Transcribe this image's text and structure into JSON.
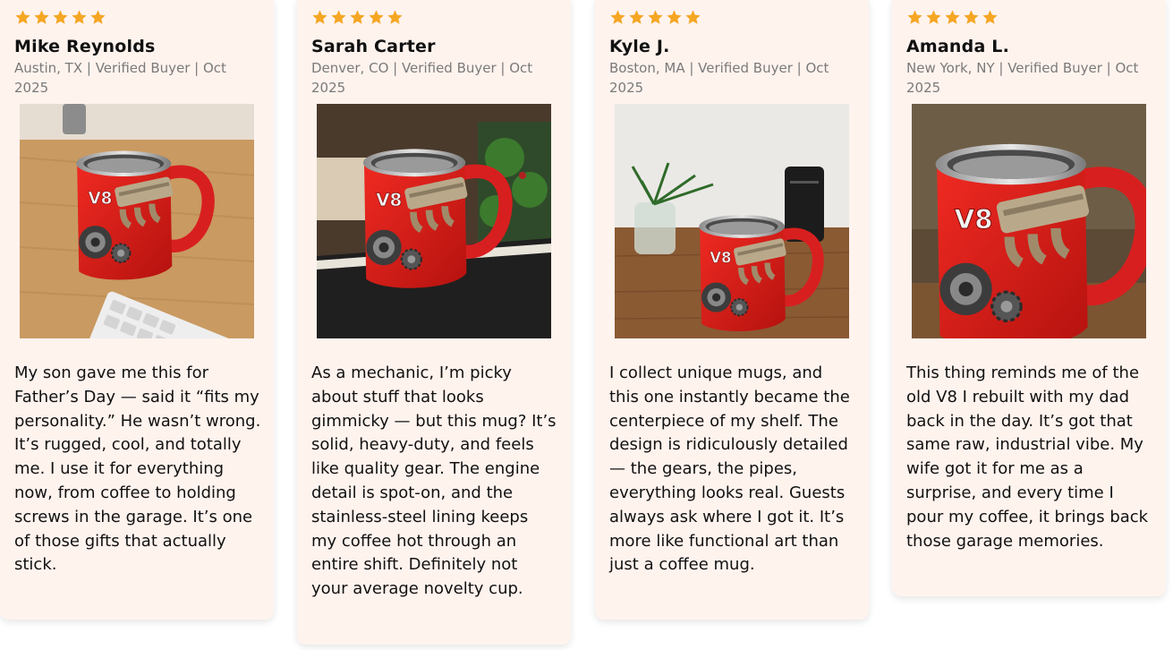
{
  "colors": {
    "star": "#f5a623",
    "card_bg": "#fff3ee",
    "mug_red": "#d81f1f"
  },
  "reviews": [
    {
      "rating": 5,
      "name": "Mike Reynolds",
      "meta": "Austin, TX | Verified Buyer | Oct 2025",
      "photo": "mug-on-desk-with-keyboard",
      "text": "My son gave me this for Father’s Day — said it “fits my personality.” He wasn’t wrong. It’s rugged, cool, and totally me. I use it for everything now, from coffee to holding screws in the garage. It’s one of those gifts that actually stick."
    },
    {
      "rating": 5,
      "name": "Sarah Carter",
      "meta": "Denver, CO | Verified Buyer | Oct 2025",
      "photo": "mug-on-notebook-with-plant",
      "text": "As a mechanic, I’m picky about stuff that looks gimmicky — but this mug? It’s solid, heavy-duty, and feels like quality gear. The engine detail is spot-on, and the stainless-steel lining keeps my coffee hot through an entire shift. Definitely not your average novelty cup."
    },
    {
      "rating": 5,
      "name": "Kyle J.",
      "meta": "Boston, MA | Verified Buyer | Oct 2025",
      "photo": "mug-on-shelf-with-jar",
      "text": "I collect unique mugs, and this one instantly became the centerpiece of my shelf. The design is ridiculously detailed — the gears, the pipes, everything looks real. Guests always ask where I got it. It’s more like functional art than just a coffee mug."
    },
    {
      "rating": 5,
      "name": "Amanda L.",
      "meta": "New York, NY | Verified Buyer | Oct 2025",
      "photo": "mug-closeup",
      "text": "This thing reminds me of the old V8 I rebuilt with my dad back in the day. It’s got that same raw, industrial vibe. My wife got it for me as a surprise, and every time I pour my coffee, it brings back those garage memories."
    }
  ]
}
